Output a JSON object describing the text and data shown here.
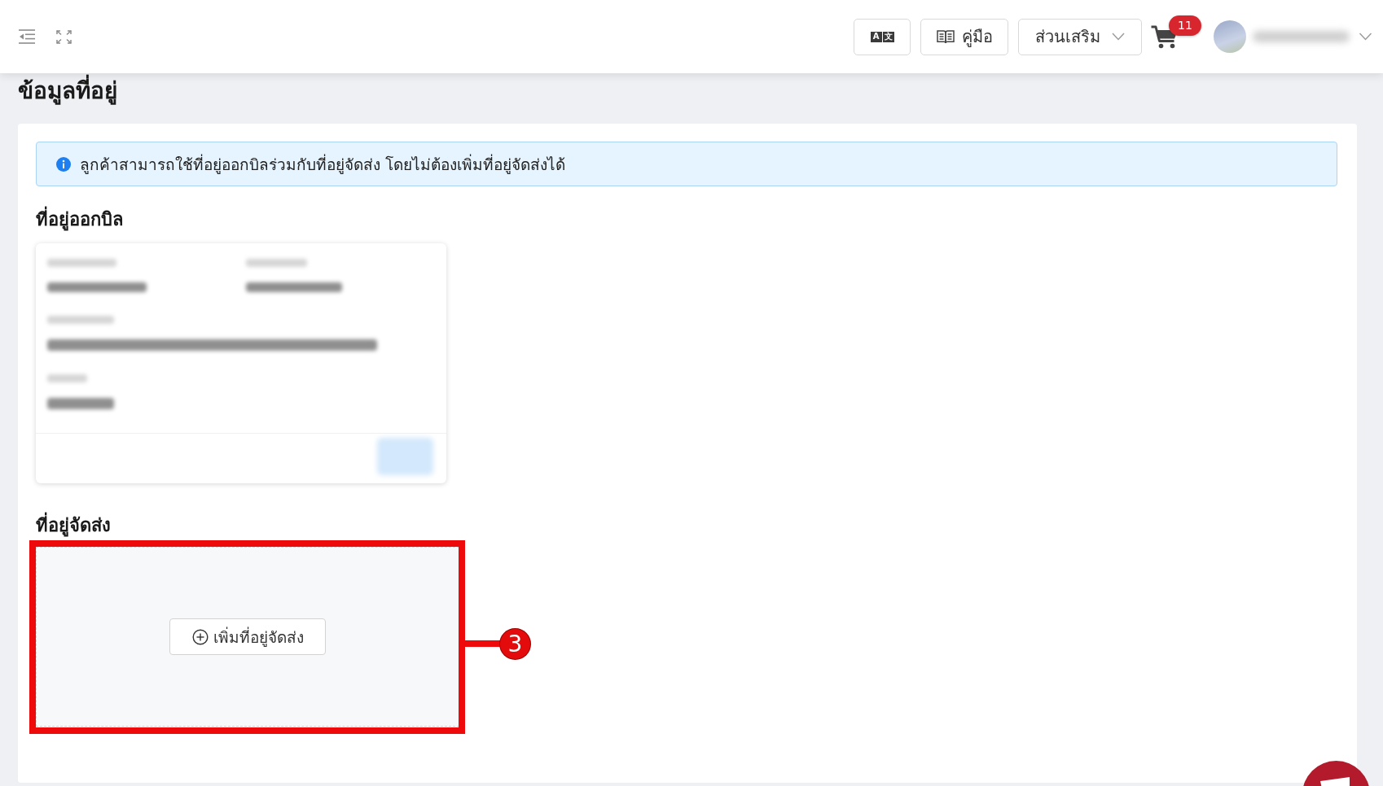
{
  "header": {
    "toolbar": [
      {
        "kind": "translate",
        "glyphs": [
          "A",
          "文"
        ]
      },
      {
        "kind": "manual",
        "label": "คู่มือ"
      },
      {
        "kind": "dropdown",
        "label": "ส่วนเสริม"
      }
    ],
    "cart": {
      "badge": "11"
    }
  },
  "page_title": "ข้อมูลที่อยู่",
  "info_banner": "ลูกค้าสามารถใช้ที่อยู่ออกบิลร่วมกับที่อยู่จัดส่ง โดยไม่ต้องเพิ่มที่อยู่จัดส่งได้",
  "billing_address": {
    "heading": "ที่อยู่ออกบิล"
  },
  "shipping_address": {
    "heading": "ที่อยู่จัดส่ง",
    "add_button": "เพิ่มที่อยู่จัดส่ง"
  },
  "annotation": {
    "number": "3"
  }
}
